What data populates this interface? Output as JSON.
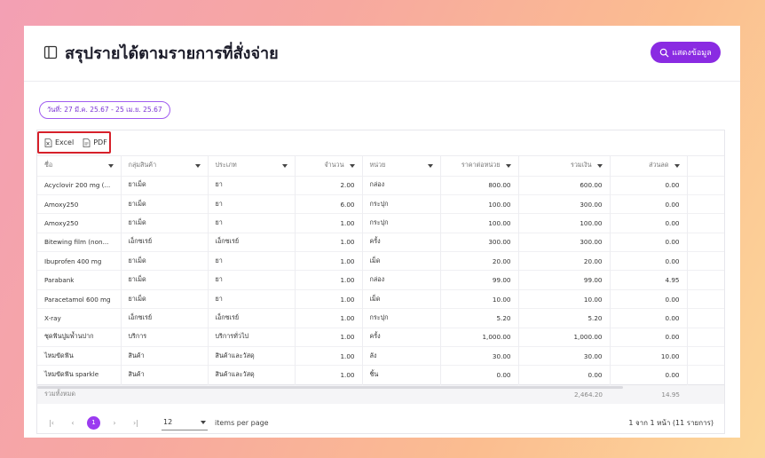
{
  "header": {
    "title": "สรุปรายได้ตามรายการที่สั่งจ่าย",
    "show_button": "แสดงข้อมูล"
  },
  "filter": {
    "date_range": "วันที่: 27 มี.ค. 25.67 - 25 เม.ย. 25.67"
  },
  "toolbar": {
    "excel": "Excel",
    "pdf": "PDF"
  },
  "table": {
    "columns": [
      "ชื่อ",
      "กลุ่มสินค้า",
      "ประเภท",
      "จำนวน",
      "หน่วย",
      "ราคาต่อหน่วย",
      "รวมเงิน",
      "ส่วนลด"
    ],
    "rows": [
      [
        "Acyclovir 200 mg (...",
        "ยาเม็ด",
        "ยา",
        "2.00",
        "กล่อง",
        "800.00",
        "600.00",
        "0.00"
      ],
      [
        "Amoxy250",
        "ยาเม็ด",
        "ยา",
        "6.00",
        "กระปุก",
        "100.00",
        "300.00",
        "0.00"
      ],
      [
        "Amoxy250",
        "ยาเม็ด",
        "ยา",
        "1.00",
        "กระปุก",
        "100.00",
        "100.00",
        "0.00"
      ],
      [
        "Bitewing film (non...",
        "เอ็กซเรย์",
        "เอ็กซเรย์",
        "1.00",
        "ครั้ง",
        "300.00",
        "300.00",
        "0.00"
      ],
      [
        "Ibuprofen 400 mg",
        "ยาเม็ด",
        "ยา",
        "1.00",
        "เม็ด",
        "20.00",
        "20.00",
        "0.00"
      ],
      [
        "Parabank",
        "ยาเม็ด",
        "ยา",
        "1.00",
        "กล่อง",
        "99.00",
        "99.00",
        "4.95"
      ],
      [
        "Paracetamol 600 mg",
        "ยาเม็ด",
        "ยา",
        "1.00",
        "เม็ด",
        "10.00",
        "10.00",
        "0.00"
      ],
      [
        "X-ray",
        "เอ็กซเรย์",
        "เอ็กซเรย์",
        "1.00",
        "กระปุก",
        "5.20",
        "5.20",
        "0.00"
      ],
      [
        "ชุดฟันปูมพ้ำนปาก",
        "บริการ",
        "บริการทั่วไป",
        "1.00",
        "ครั้ง",
        "1,000.00",
        "1,000.00",
        "0.00"
      ],
      [
        "ไหมขัดฟัน",
        "สินค้า",
        "สินค้าและวัสดุ",
        "1.00",
        "ลัง",
        "30.00",
        "30.00",
        "10.00"
      ],
      [
        "ไหมขัดฟัน sparkle",
        "สินค้า",
        "สินค้าและวัสดุ",
        "1.00",
        "ชิ้น",
        "0.00",
        "0.00",
        "0.00"
      ]
    ],
    "total_label": "รวมทั้งหมด",
    "total_amount": "2,464.20",
    "total_discount": "14.95"
  },
  "pagination": {
    "current_page": "1",
    "items_per_page": "12",
    "items_per_page_label": "items per page",
    "range_text": "1 จาก 1 หน้า (11 รายการ)"
  },
  "colors": {
    "accent": "#8a2be2",
    "highlight_border": "#d6202a"
  }
}
